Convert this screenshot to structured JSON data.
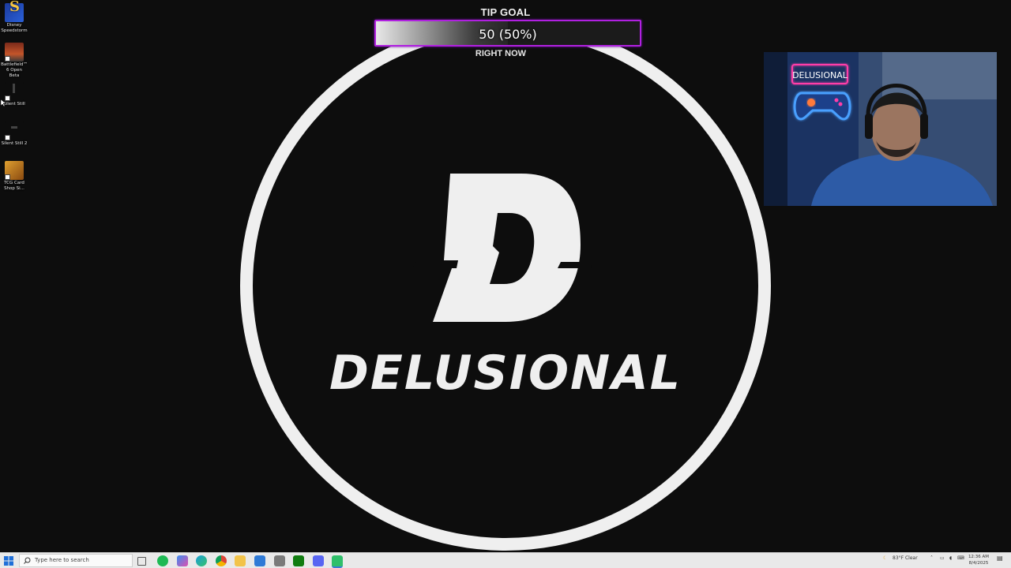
{
  "desktop": {
    "icons": [
      {
        "label": "Disney Speedstorm",
        "icon": "disney-speedstorm-icon"
      },
      {
        "label": "Battlefield™ 6 Open Beta",
        "icon": "battlefield-icon"
      },
      {
        "label": "Silent Still",
        "icon": "silent-still-icon"
      },
      {
        "label": "Silent Still 2",
        "icon": "silent-still-2-icon"
      },
      {
        "label": "TCG Card Shop Si...",
        "icon": "tcg-card-shop-icon"
      }
    ]
  },
  "tip_goal": {
    "title": "TIP GOAL",
    "value_text": "50 (50%)",
    "progress_fraction": 0.5,
    "subtitle": "RIGHT NOW",
    "border_color": "#b020e0"
  },
  "logo": {
    "letter": "D",
    "text": "DELUSIONAL"
  },
  "webcam": {
    "neon_sign": "DELUSIONAL",
    "neon_color": "#ff3da8"
  },
  "taskbar": {
    "search_placeholder": "Type here to search",
    "apps": [
      "task-view-icon",
      "spotify-icon",
      "copilot-icon",
      "edge-icon",
      "chrome-icon",
      "file-explorer-icon",
      "mail-icon",
      "calculator-icon",
      "xbox-icon",
      "discord-icon",
      "app-icon"
    ],
    "weather": "83°F  Clear",
    "time": "12:36 AM",
    "date": "8/4/2025"
  }
}
